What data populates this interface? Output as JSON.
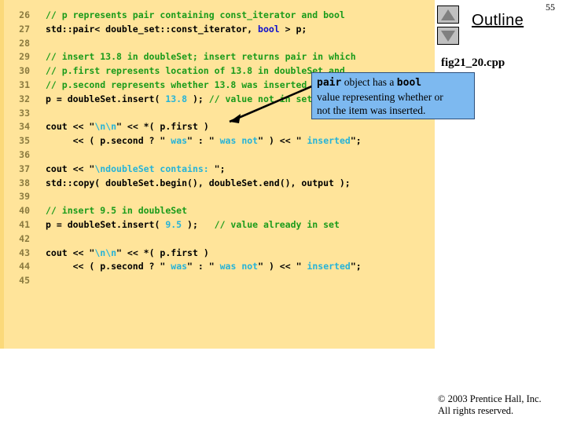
{
  "page": {
    "number": "55",
    "background_color": "#ffffff"
  },
  "code_panel": {
    "background_color": "#ffe49a",
    "comment_color": "#1a9b1a",
    "keyword_color": "#1111cc",
    "string_color": "#26b3d8",
    "line_number_color": "#8a7a3f",
    "lines": [
      {
        "n": "26",
        "segments": [
          {
            "t": "// p represents pair containing const_iterator and bool",
            "c": "cmt"
          }
        ]
      },
      {
        "n": "27",
        "segments": [
          {
            "t": "std::pair< double_set::const_iterator, ",
            "c": "pun"
          },
          {
            "t": "bool",
            "c": "kw"
          },
          {
            "t": " > p;",
            "c": "pun"
          }
        ]
      },
      {
        "n": "28",
        "segments": [
          {
            "t": "",
            "c": "pun"
          }
        ]
      },
      {
        "n": "29",
        "segments": [
          {
            "t": "// insert 13.8 in doubleSet; insert returns pair in which",
            "c": "cmt"
          }
        ]
      },
      {
        "n": "30",
        "segments": [
          {
            "t": "// p.first represents location of 13.8 in doubleSet and",
            "c": "cmt"
          }
        ]
      },
      {
        "n": "31",
        "segments": [
          {
            "t": "// p.second represents whether 13.8 was inserted",
            "c": "cmt"
          }
        ]
      },
      {
        "n": "32",
        "segments": [
          {
            "t": "p = doubleSet.insert( ",
            "c": "pun"
          },
          {
            "t": "13.8",
            "c": "num"
          },
          {
            "t": " ); ",
            "c": "pun"
          },
          {
            "t": "// value not in set",
            "c": "cmt"
          }
        ]
      },
      {
        "n": "33",
        "segments": [
          {
            "t": "",
            "c": "pun"
          }
        ]
      },
      {
        "n": "34",
        "segments": [
          {
            "t": "cout << ",
            "c": "pun"
          },
          {
            "t": "\"",
            "c": "pun"
          },
          {
            "t": "\\n\\n",
            "c": "str"
          },
          {
            "t": "\"",
            "c": "pun"
          },
          {
            "t": " << *( p.first )",
            "c": "pun"
          }
        ]
      },
      {
        "n": "35",
        "segments": [
          {
            "t": "     << ( p.second ? ",
            "c": "pun"
          },
          {
            "t": "\"",
            "c": "pun"
          },
          {
            "t": " was",
            "c": "str"
          },
          {
            "t": "\"",
            "c": "pun"
          },
          {
            "t": " : ",
            "c": "pun"
          },
          {
            "t": "\"",
            "c": "pun"
          },
          {
            "t": " was not",
            "c": "str"
          },
          {
            "t": "\"",
            "c": "pun"
          },
          {
            "t": " ) << ",
            "c": "pun"
          },
          {
            "t": "\"",
            "c": "pun"
          },
          {
            "t": " inserted",
            "c": "str"
          },
          {
            "t": "\"",
            "c": "pun"
          },
          {
            "t": ";",
            "c": "pun"
          }
        ]
      },
      {
        "n": "36",
        "segments": [
          {
            "t": "",
            "c": "pun"
          }
        ]
      },
      {
        "n": "37",
        "segments": [
          {
            "t": "cout << ",
            "c": "pun"
          },
          {
            "t": "\"",
            "c": "pun"
          },
          {
            "t": "\\ndoubleSet contains: ",
            "c": "str"
          },
          {
            "t": "\"",
            "c": "pun"
          },
          {
            "t": ";",
            "c": "pun"
          }
        ]
      },
      {
        "n": "38",
        "segments": [
          {
            "t": "std::copy( doubleSet.begin(), doubleSet.end(), output );",
            "c": "pun"
          }
        ]
      },
      {
        "n": "39",
        "segments": [
          {
            "t": "",
            "c": "pun"
          }
        ]
      },
      {
        "n": "40",
        "segments": [
          {
            "t": "// insert 9.5 in doubleSet",
            "c": "cmt"
          }
        ]
      },
      {
        "n": "41",
        "segments": [
          {
            "t": "p = doubleSet.insert( ",
            "c": "pun"
          },
          {
            "t": "9.5",
            "c": "num"
          },
          {
            "t": " );   ",
            "c": "pun"
          },
          {
            "t": "// value already in set",
            "c": "cmt"
          }
        ]
      },
      {
        "n": "42",
        "segments": [
          {
            "t": "",
            "c": "pun"
          }
        ]
      },
      {
        "n": "43",
        "segments": [
          {
            "t": "cout << ",
            "c": "pun"
          },
          {
            "t": "\"",
            "c": "pun"
          },
          {
            "t": "\\n\\n",
            "c": "str"
          },
          {
            "t": "\"",
            "c": "pun"
          },
          {
            "t": " << *( p.first )",
            "c": "pun"
          }
        ]
      },
      {
        "n": "44",
        "segments": [
          {
            "t": "     << ( p.second ? ",
            "c": "pun"
          },
          {
            "t": "\"",
            "c": "pun"
          },
          {
            "t": " was",
            "c": "str"
          },
          {
            "t": "\"",
            "c": "pun"
          },
          {
            "t": " : ",
            "c": "pun"
          },
          {
            "t": "\"",
            "c": "pun"
          },
          {
            "t": " was not",
            "c": "str"
          },
          {
            "t": "\"",
            "c": "pun"
          },
          {
            "t": " ) << ",
            "c": "pun"
          },
          {
            "t": "\"",
            "c": "pun"
          },
          {
            "t": " inserted",
            "c": "str"
          },
          {
            "t": "\"",
            "c": "pun"
          },
          {
            "t": ";",
            "c": "pun"
          }
        ]
      },
      {
        "n": "45",
        "segments": [
          {
            "t": "",
            "c": "pun"
          }
        ]
      }
    ]
  },
  "callout": {
    "background_color": "#7db9f0",
    "border_color": "#2d4f7c",
    "line1_code": "pair",
    "line1_mid": " object has a ",
    "line1_code2": "bool",
    "line2": "value representing whether or",
    "line3": "not the item was inserted."
  },
  "sidebar": {
    "outline_label": "Outline",
    "file_name": "fig21_20.cpp",
    "nav_up_icon": "triangle-up-icon",
    "nav_down_icon": "triangle-down-icon"
  },
  "footer": {
    "copyright_line1": "© 2003 Prentice Hall, Inc.",
    "copyright_line2": "All rights reserved."
  }
}
